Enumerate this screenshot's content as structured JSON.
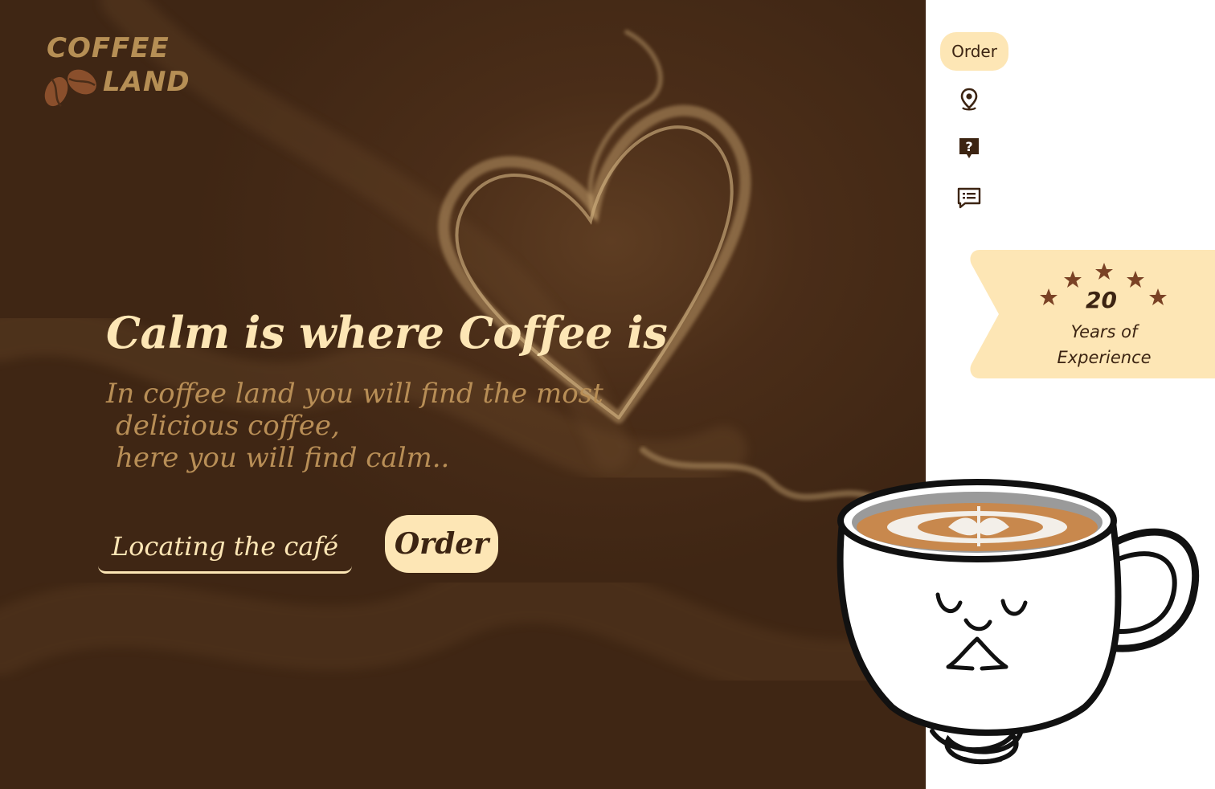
{
  "brand": {
    "line1": "COFFEE",
    "line2": "LAND"
  },
  "hero": {
    "headline": "Calm is where Coffee is",
    "subline": [
      "In coffee land you will find the most",
      "delicious coffee,",
      "here you will find calm.."
    ],
    "locate_label": "Locating the café",
    "order_label": "Order"
  },
  "sidebar": {
    "order_label": "Order",
    "icons": [
      "location-pin-icon",
      "help-icon",
      "message-icon"
    ]
  },
  "badge": {
    "number": "20",
    "text_line1": "Years of",
    "text_line2": "Experience",
    "stars": 5
  },
  "colors": {
    "hero_bg": "#4a2d18",
    "accent_cream": "#fde6b5",
    "logo_gold": "#b68f55",
    "subtext": "#b88e56",
    "star_brown": "#7a4225",
    "text_dark": "#3c2412"
  }
}
